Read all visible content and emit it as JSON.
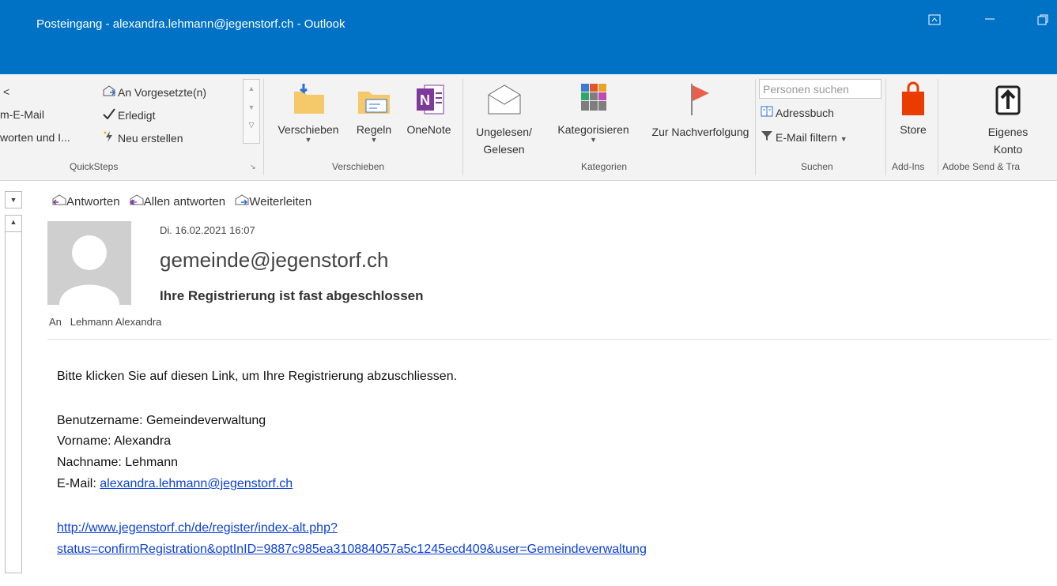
{
  "window": {
    "title": "Posteingang - alexandra.lehmann@jegenstorf.ch - Outlook"
  },
  "ribbon": {
    "quicksteps": {
      "items_left": [
        "<",
        "m-E-Mail",
        "worten und I..."
      ],
      "items_right": [
        "An Vorgesetzte(n)",
        "Erledigt",
        "Neu erstellen"
      ],
      "label": "QuickSteps"
    },
    "verschieben": {
      "buttons": [
        "Verschieben",
        "Regeln",
        "OneNote"
      ],
      "label": "Verschieben"
    },
    "kategorien": {
      "ungelesen": "Ungelesen/ Gelesen",
      "kategorisieren": "Kategorisieren",
      "nachverfolgung": "Zur Nachverfolgung",
      "label": "Kategorien"
    },
    "suchen": {
      "placeholder": "Personen suchen",
      "adressbuch": "Adressbuch",
      "filter": "E-Mail filtern",
      "label": "Suchen"
    },
    "addins": {
      "store": "Store",
      "label": "Add-Ins"
    },
    "adobe": {
      "konto": "Eigenes Konto",
      "label": "Adobe Send & Tra"
    }
  },
  "message": {
    "actions": [
      "Antworten",
      "Allen antworten",
      "Weiterleiten"
    ],
    "date": "Di. 16.02.2021 16:07",
    "sender": "gemeinde@jegenstorf.ch",
    "subject": "Ihre Registrierung ist fast abgeschlossen",
    "to_label": "An",
    "to_name": "Lehmann Alexandra",
    "intro": "Bitte klicken Sie auf diesen Link, um Ihre Registrierung abzuschliessen.",
    "username": "Benutzername: Gemeindeverwaltung",
    "firstname": "Vorname: Alexandra",
    "lastname": "Nachname: Lehmann",
    "email_label": "E-Mail: ",
    "email_link": "alexandra.lehmann@jegenstorf.ch",
    "link_line1": "http://www.jegenstorf.ch/de/register/index-alt.php?",
    "link_line2": "status=confirmRegistration&optInID=9887c985ea310884057a5c1245ecd409&user=Gemeindeverwaltung"
  },
  "colors": {
    "titlebar": "#0072c6",
    "link": "#0b3fd8",
    "flag": "#e8604c",
    "store": "#eb3c00"
  }
}
